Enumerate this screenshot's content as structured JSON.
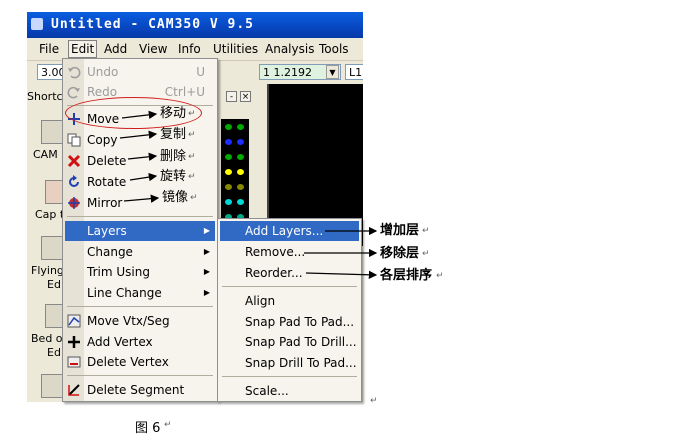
{
  "window": {
    "title": "Untitled - CAM350 V 9.5"
  },
  "menubar": {
    "items": [
      "File",
      "Edit",
      "Add",
      "View",
      "Info",
      "Utilities",
      "Analysis",
      "Tools"
    ]
  },
  "toolbar": {
    "field1": "3.00",
    "field2": "1 1.2192",
    "field3": "L1"
  },
  "left_panel": {
    "header": "Shortc",
    "labels": [
      "CAM",
      "Cap t",
      "Flying",
      "Ed",
      "Bed o",
      "Ed"
    ]
  },
  "edit_menu": {
    "items": [
      {
        "label": "Undo",
        "shortcut": "U",
        "disabled": true,
        "icon": "undo-icon"
      },
      {
        "label": "Redo",
        "shortcut": "Ctrl+U",
        "disabled": true,
        "icon": "redo-icon"
      },
      {
        "label": "Move",
        "icon": "move-icon"
      },
      {
        "label": "Copy",
        "icon": "copy-icon"
      },
      {
        "label": "Delete",
        "icon": "delete-icon"
      },
      {
        "label": "Rotate",
        "icon": "rotate-icon"
      },
      {
        "label": "Mirror",
        "icon": "mirror-icon"
      },
      {
        "label": "Layers",
        "submenu": true,
        "selected": true
      },
      {
        "label": "Change",
        "submenu": true
      },
      {
        "label": "Trim Using",
        "submenu": true
      },
      {
        "label": "Line Change",
        "submenu": true
      },
      {
        "label": "Move Vtx/Seg",
        "icon": "move-vertex-icon"
      },
      {
        "label": "Add Vertex",
        "icon": "add-vertex-icon"
      },
      {
        "label": "Delete Vertex",
        "icon": "delete-vertex-icon"
      },
      {
        "label": "Delete Segment",
        "icon": "delete-segment-icon"
      }
    ]
  },
  "layers_submenu": {
    "items": [
      "Add Layers...",
      "Remove...",
      "Reorder...",
      "Align",
      "Snap Pad To Pad...",
      "Snap Pad To Drill...",
      "Snap Drill To Pad...",
      "Scale..."
    ]
  },
  "annotations": {
    "move": "移动",
    "copy": "复制",
    "delete": "删除",
    "rotate": "旋转",
    "mirror": "镜像",
    "add_layers": "增加层",
    "remove": "移除层",
    "reorder": "各层排序"
  },
  "return_mark": "↵",
  "caption": "图 6",
  "colors": {
    "selection": "#316ac5",
    "annotation_oval": "#d21c1c",
    "title_bar": "#0846c0"
  }
}
